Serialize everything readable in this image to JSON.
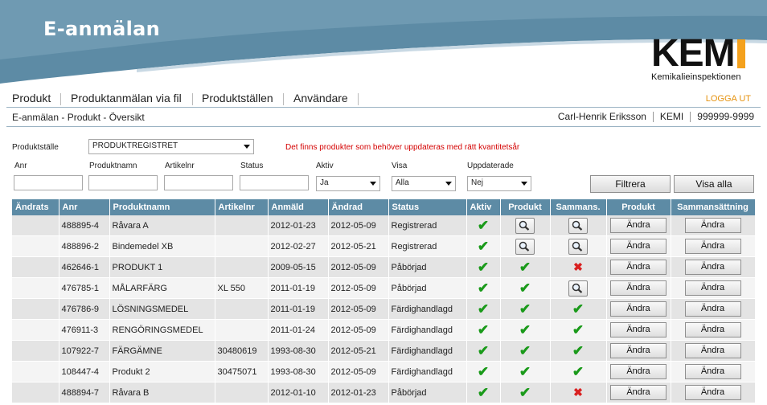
{
  "app": {
    "title": "E-anmälan"
  },
  "logo": {
    "mark": "KEM",
    "subtitle": "Kemikalieinspektionen"
  },
  "nav": {
    "items": [
      "Produkt",
      "Produktanmälan via fil",
      "Produktställen",
      "Användare"
    ],
    "logout": "LOGGA UT"
  },
  "breadcrumb": "E-anmälan - Produkt - Översikt",
  "user": {
    "name": "Carl-Henrik Eriksson",
    "org": "KEMI",
    "id": "999999-9999"
  },
  "filters": {
    "produktstalle_label": "Produktställe",
    "produktstalle_value": "PRODUKTREGISTRET",
    "warning": "Det finns produkter som behöver uppdateras med rätt kvantitetsår",
    "anr_label": "Anr",
    "produktnamn_label": "Produktnamn",
    "artikelnr_label": "Artikelnr",
    "status_label": "Status",
    "aktiv_label": "Aktiv",
    "aktiv_value": "Ja",
    "visa_label": "Visa",
    "visa_value": "Alla",
    "uppdaterade_label": "Uppdaterade",
    "uppdaterade_value": "Nej",
    "filter_button": "Filtrera",
    "show_all_button": "Visa alla"
  },
  "table": {
    "headers": [
      "Ändrats",
      "Anr",
      "Produktnamn",
      "Artikelnr",
      "Anmäld",
      "Ändrad",
      "Status",
      "Aktiv",
      "Produkt",
      "Sammans.",
      "Produkt",
      "Sammansättning"
    ],
    "edit_label": "Ändra",
    "rows": [
      {
        "changed": "",
        "anr": "488895-4",
        "name": "Råvara A",
        "art": "",
        "reported": "2012-01-23",
        "modified": "2012-05-09",
        "status": "Registrerad",
        "active": "check",
        "product": "search",
        "composition": "search"
      },
      {
        "changed": "",
        "anr": "488896-2",
        "name": "Bindemedel XB",
        "art": "",
        "reported": "2012-02-27",
        "modified": "2012-05-21",
        "status": "Registrerad",
        "active": "check",
        "product": "search",
        "composition": "search"
      },
      {
        "changed": "",
        "anr": "462646-1",
        "name": "PRODUKT 1",
        "art": "",
        "reported": "2009-05-15",
        "modified": "2012-05-09",
        "status": "Påbörjad",
        "active": "check",
        "product": "check",
        "composition": "cross"
      },
      {
        "changed": "",
        "anr": "476785-1",
        "name": "MÅLARFÄRG",
        "art": "XL 550",
        "reported": "2011-01-19",
        "modified": "2012-05-09",
        "status": "Påbörjad",
        "active": "check",
        "product": "check",
        "composition": "search"
      },
      {
        "changed": "",
        "anr": "476786-9",
        "name": "LÖSNINGSMEDEL",
        "art": "",
        "reported": "2011-01-19",
        "modified": "2012-05-09",
        "status": "Färdighandlagd",
        "active": "check",
        "product": "check",
        "composition": "check"
      },
      {
        "changed": "",
        "anr": "476911-3",
        "name": "RENGÖRINGSMEDEL",
        "art": "",
        "reported": "2011-01-24",
        "modified": "2012-05-09",
        "status": "Färdighandlagd",
        "active": "check",
        "product": "check",
        "composition": "check"
      },
      {
        "changed": "",
        "anr": "107922-7",
        "name": "FÄRGÄMNE",
        "art": "30480619",
        "reported": "1993-08-30",
        "modified": "2012-05-21",
        "status": "Färdighandlagd",
        "active": "check",
        "product": "check",
        "composition": "check"
      },
      {
        "changed": "",
        "anr": "108447-4",
        "name": "Produkt 2",
        "art": "30475071",
        "reported": "1993-08-30",
        "modified": "2012-05-09",
        "status": "Färdighandlagd",
        "active": "check",
        "product": "check",
        "composition": "check"
      },
      {
        "changed": "",
        "anr": "488894-7",
        "name": "Råvara B",
        "art": "",
        "reported": "2012-01-10",
        "modified": "2012-01-23",
        "status": "Påbörjad",
        "active": "check",
        "product": "check",
        "composition": "cross"
      }
    ]
  },
  "colors": {
    "banner": "#5d8ba5",
    "header": "#5d8ba5",
    "check": "#1a9a1a",
    "cross": "#d92020",
    "logout": "#e5920f",
    "warning": "#d40000",
    "logo_bar": "#f4a11d"
  }
}
